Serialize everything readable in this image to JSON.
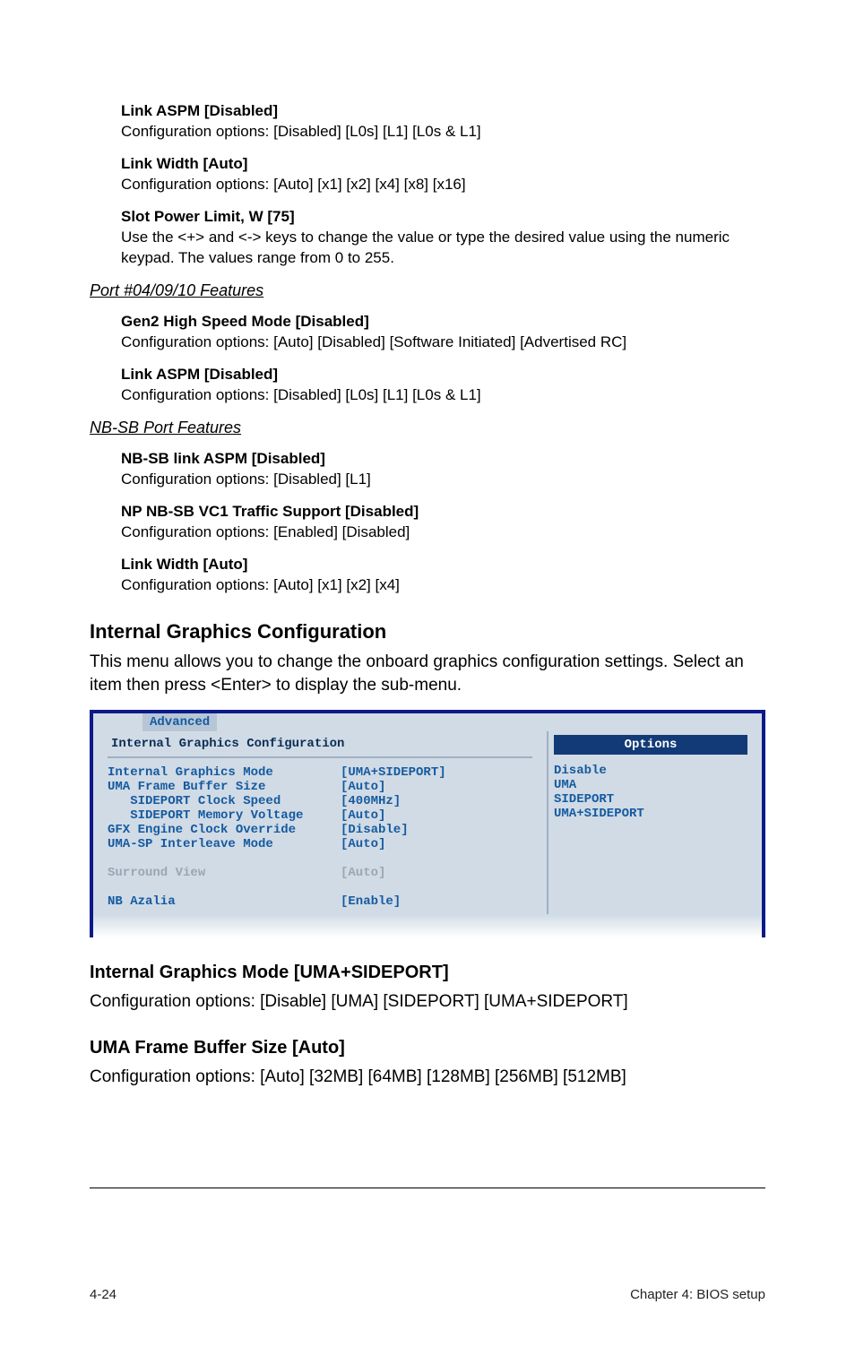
{
  "items": {
    "linkASPM1": {
      "heading": "Link ASPM [Disabled]",
      "body": "Configuration options: [Disabled] [L0s] [L1] [L0s & L1]"
    },
    "linkWidth1": {
      "heading": "Link Width [Auto]",
      "body": "Configuration options: [Auto] [x1] [x2] [x4] [x8] [x16]"
    },
    "slotPower": {
      "heading": "Slot Power Limit, W [75]",
      "body": "Use the <+> and <-> keys to change the value or type the desired value using the numeric keypad. The values range from 0 to 255."
    }
  },
  "sections": {
    "portFeatures": {
      "title": "Port #04/09/10 Features",
      "gen2": {
        "heading": "Gen2 High Speed Mode [Disabled]",
        "body": "Configuration options: [Auto] [Disabled] [Software Initiated] [Advertised RC]"
      },
      "linkASPM": {
        "heading": "Link ASPM [Disabled]",
        "body": "Configuration options: [Disabled] [L0s] [L1] [L0s & L1]"
      }
    },
    "nbsb": {
      "title": "NB-SB Port Features",
      "linkASPM": {
        "heading": "NB-SB link ASPM [Disabled]",
        "body": "Configuration options: [Disabled] [L1]"
      },
      "traffic": {
        "heading": "NP NB-SB VC1 Traffic Support [Disabled]",
        "body": "Configuration options: [Enabled] [Disabled]"
      },
      "linkWidth": {
        "heading": "Link Width [Auto]",
        "body": "Configuration options: [Auto] [x1] [x2] [x4]"
      }
    }
  },
  "igc": {
    "heading": "Internal Graphics Configuration",
    "para": "This menu allows you to change the onboard graphics configuration settings. Select an item then press <Enter> to display the sub-menu."
  },
  "bios": {
    "tab": "Advanced",
    "title": "Internal Graphics Configuration",
    "rightHeader": "Options",
    "options": [
      "Disable",
      "UMA",
      "SIDEPORT",
      "UMA+SIDEPORT"
    ],
    "rows": [
      {
        "label": "Internal Graphics Mode",
        "value": "[UMA+SIDEPORT]",
        "grey": false
      },
      {
        "label": "UMA Frame Buffer Size",
        "value": "[Auto]",
        "grey": false
      },
      {
        "label": "   SIDEPORT Clock Speed",
        "value": "[400MHz]",
        "grey": false
      },
      {
        "label": "   SIDEPORT Memory Voltage",
        "value": "[Auto]",
        "grey": false
      },
      {
        "label": "GFX Engine Clock Override",
        "value": "[Disable]",
        "grey": false
      },
      {
        "label": "UMA-SP Interleave Mode",
        "value": "[Auto]",
        "grey": false
      },
      {
        "label": "",
        "value": "",
        "grey": false
      },
      {
        "label": "Surround View",
        "value": "[Auto]",
        "grey": true
      },
      {
        "label": "",
        "value": "",
        "grey": false
      },
      {
        "label": "NB Azalia",
        "value": "[Enable]",
        "grey": false
      }
    ]
  },
  "post": {
    "igm": {
      "heading": "Internal Graphics Mode [UMA+SIDEPORT]",
      "body": "Configuration options: [Disable] [UMA] [SIDEPORT] [UMA+SIDEPORT]"
    },
    "uma": {
      "heading": "UMA Frame Buffer Size [Auto]",
      "body": "Configuration options: [Auto] [32MB] [64MB] [128MB] [256MB] [512MB]"
    }
  },
  "footer": {
    "left": "4-24",
    "right": "Chapter 4: BIOS setup"
  }
}
